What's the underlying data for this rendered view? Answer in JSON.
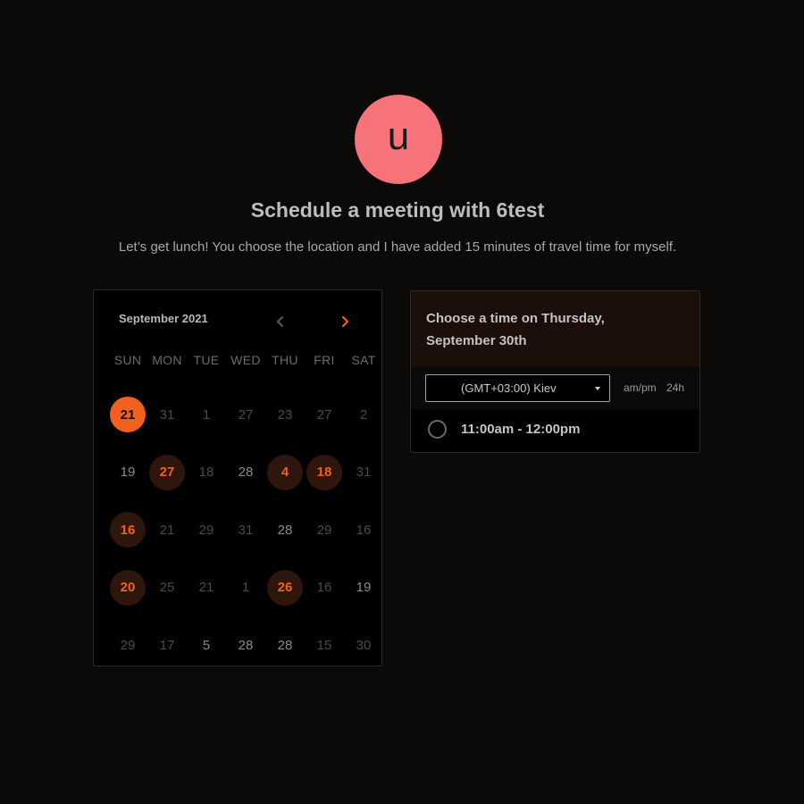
{
  "profile": {
    "avatar_letter": "u",
    "avatar_color": "#f7737a"
  },
  "header": {
    "title": "Schedule a meeting with 6test",
    "subtitle": "Let’s get lunch! You choose the location and I have added 15 minutes of travel time for myself."
  },
  "calendar": {
    "month_label": "September 2021",
    "prev_icon": "chevron-left-icon",
    "next_icon": "chevron-right-icon",
    "weekdays": [
      "SUN",
      "MON",
      "TUE",
      "WED",
      "THU",
      "FRI",
      "SAT"
    ],
    "accent_color": "#f2601f",
    "weeks": [
      [
        {
          "label": "21",
          "state": "selected"
        },
        {
          "label": "31",
          "state": "dim"
        },
        {
          "label": "1",
          "state": "dim"
        },
        {
          "label": "27",
          "state": "dim"
        },
        {
          "label": "23",
          "state": "dim"
        },
        {
          "label": "27",
          "state": "dim"
        },
        {
          "label": "2",
          "state": "dim"
        }
      ],
      [
        {
          "label": "19",
          "state": "mid"
        },
        {
          "label": "27",
          "state": "available"
        },
        {
          "label": "18",
          "state": "dim"
        },
        {
          "label": "28",
          "state": "mid"
        },
        {
          "label": "4",
          "state": "available"
        },
        {
          "label": "18",
          "state": "available"
        },
        {
          "label": "31",
          "state": "dim"
        }
      ],
      [
        {
          "label": "16",
          "state": "available"
        },
        {
          "label": "21",
          "state": "dim"
        },
        {
          "label": "29",
          "state": "dim"
        },
        {
          "label": "31",
          "state": "dim"
        },
        {
          "label": "28",
          "state": "mid"
        },
        {
          "label": "29",
          "state": "dim"
        },
        {
          "label": "16",
          "state": "dim"
        }
      ],
      [
        {
          "label": "20",
          "state": "available"
        },
        {
          "label": "25",
          "state": "dim"
        },
        {
          "label": "21",
          "state": "dim"
        },
        {
          "label": "1",
          "state": "dim"
        },
        {
          "label": "26",
          "state": "available"
        },
        {
          "label": "16",
          "state": "dim"
        },
        {
          "label": "19",
          "state": "mid"
        }
      ],
      [
        {
          "label": "29",
          "state": "dim"
        },
        {
          "label": "17",
          "state": "dim"
        },
        {
          "label": "5",
          "state": "mid"
        },
        {
          "label": "28",
          "state": "mid"
        },
        {
          "label": "28",
          "state": "mid"
        },
        {
          "label": "15",
          "state": "dim"
        },
        {
          "label": "30",
          "state": "dim"
        }
      ]
    ]
  },
  "times": {
    "heading": "Choose a time on Thursday, September 30th",
    "timezone": {
      "value": "(GMT+03:00) Kiev",
      "caret_icon": "caret-down-icon"
    },
    "format_ampm": "am/pm",
    "format_24h": "24h",
    "slots": [
      {
        "label": "11:00am - 12:00pm",
        "icon": "radio-unchecked-icon"
      }
    ]
  }
}
